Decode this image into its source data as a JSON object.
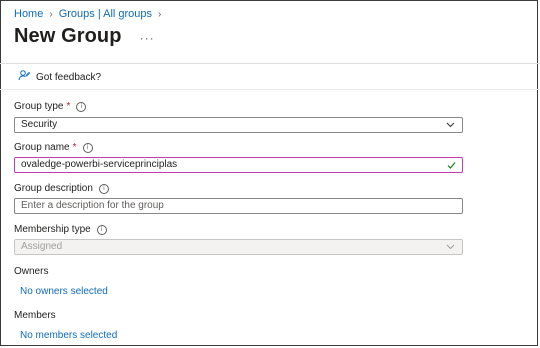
{
  "breadcrumb": {
    "home": "Home",
    "groups": "Groups | All groups"
  },
  "header": {
    "title": "New Group",
    "more": "···"
  },
  "feedback": {
    "label": "Got feedback?"
  },
  "form": {
    "group_type": {
      "label": "Group type",
      "required": "*",
      "value": "Security"
    },
    "group_name": {
      "label": "Group name",
      "required": "*",
      "value": "ovaledge-powerbi-serviceprinciplas"
    },
    "group_description": {
      "label": "Group description",
      "placeholder": "Enter a description for the group"
    },
    "membership_type": {
      "label": "Membership type",
      "value": "Assigned"
    },
    "owners": {
      "label": "Owners",
      "link": "No owners selected"
    },
    "members": {
      "label": "Members",
      "link": "No members selected"
    }
  },
  "colors": {
    "link": "#0f6cbd",
    "required": "#a4262c",
    "focus_border": "#c239b3",
    "valid_check": "#107c10"
  },
  "icons": {
    "feedback": "person-feedback-icon",
    "info": "info-icon",
    "chevron": "chevron-down-icon",
    "check": "checkmark-icon"
  }
}
